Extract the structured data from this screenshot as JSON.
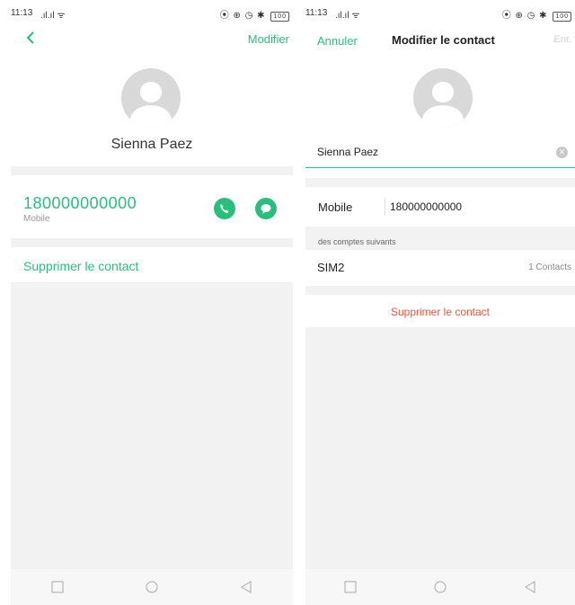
{
  "colors": {
    "accent": "#2bbd7e",
    "danger": "#e8553f",
    "separator": "#f2f2f2"
  },
  "left": {
    "status_time": "11:13",
    "status_battery": "100",
    "back_icon": "chevron-left-icon",
    "edit_label": "Modifier",
    "contact_name": "Sienna Paez",
    "phone_number": "180000000000",
    "phone_type": "Mobile",
    "call_icon": "phone-icon",
    "message_icon": "message-icon",
    "delete_label": "Supprimer le contact"
  },
  "right": {
    "status_time": "11:13",
    "status_battery": "100",
    "cancel_label": "Annuler",
    "title": "Modifier le contact",
    "save_label": "Enr.",
    "name_value": "Sienna Paez",
    "mobile_label": "Mobile",
    "mobile_value": "180000000000",
    "accounts_label": "des comptes suivants",
    "sim_label": "SIM2",
    "sim_count": "1 Contacts",
    "delete_label": "Supprimer le contact"
  },
  "navbar": {
    "icons": [
      "square-icon",
      "circle-icon",
      "triangle-back-icon"
    ]
  }
}
